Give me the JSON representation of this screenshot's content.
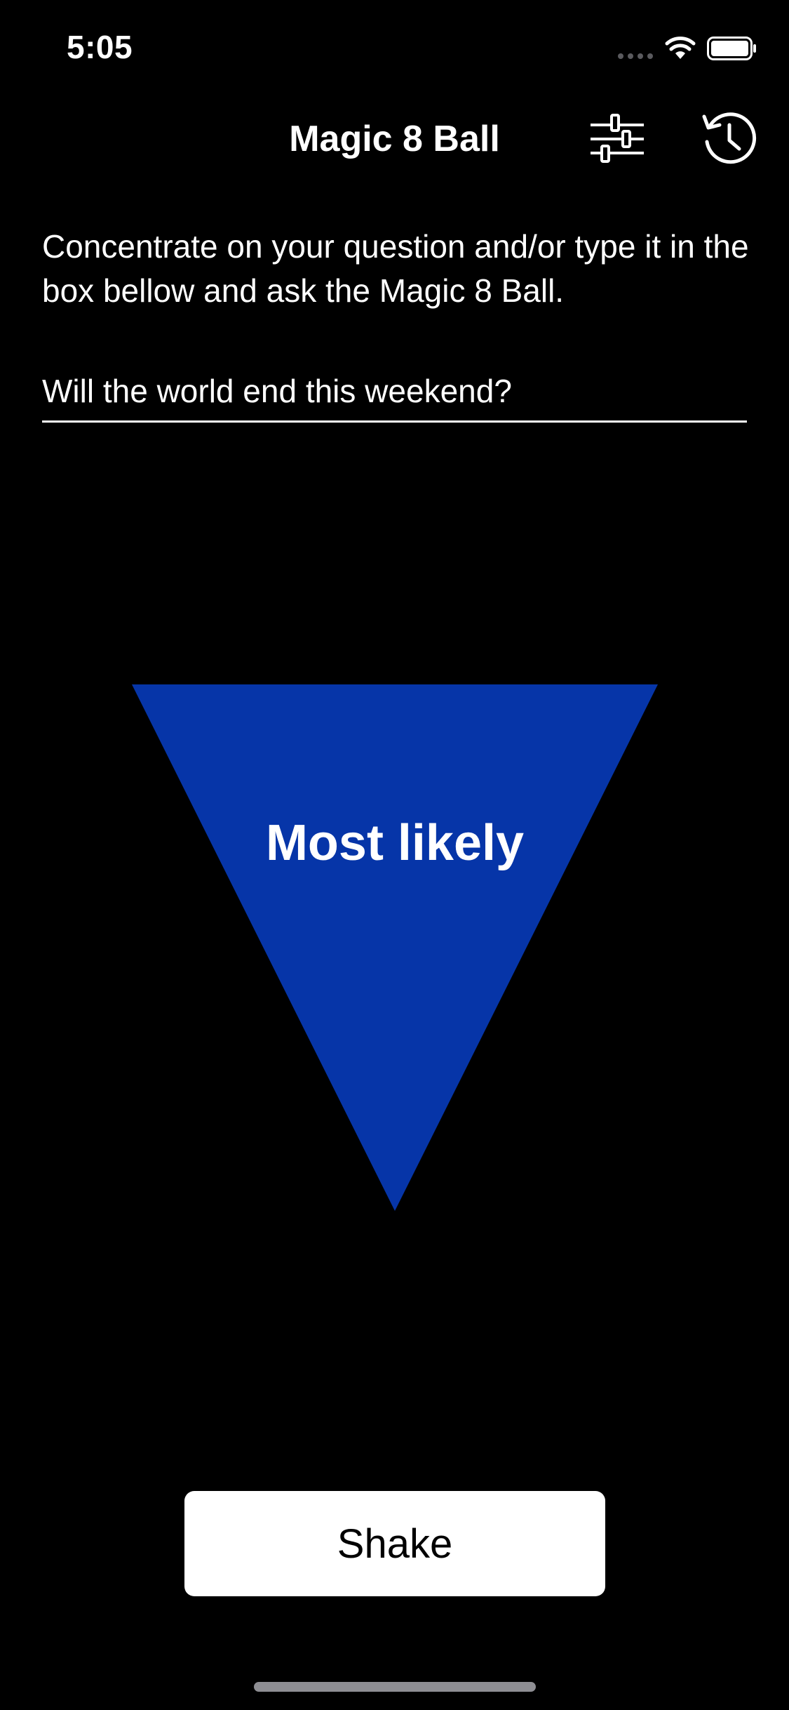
{
  "status_bar": {
    "time": "5:05",
    "signal_icon": "cellular-dots-icon",
    "wifi_icon": "wifi-icon",
    "battery_icon": "battery-icon"
  },
  "nav": {
    "title": "Magic 8 Ball",
    "settings_icon": "sliders-icon",
    "history_icon": "history-icon"
  },
  "main": {
    "instructions": "Concentrate on your question and/or type it in the box bellow and ask the Magic 8 Ball.",
    "question_value": "Will the world end this weekend?",
    "question_placeholder": "",
    "answer": "Most likely",
    "shake_label": "Shake"
  },
  "colors": {
    "background": "#000000",
    "triangle": "#0635A8",
    "text": "#FFFFFF",
    "button_bg": "#FFFFFF",
    "button_text": "#000000"
  }
}
